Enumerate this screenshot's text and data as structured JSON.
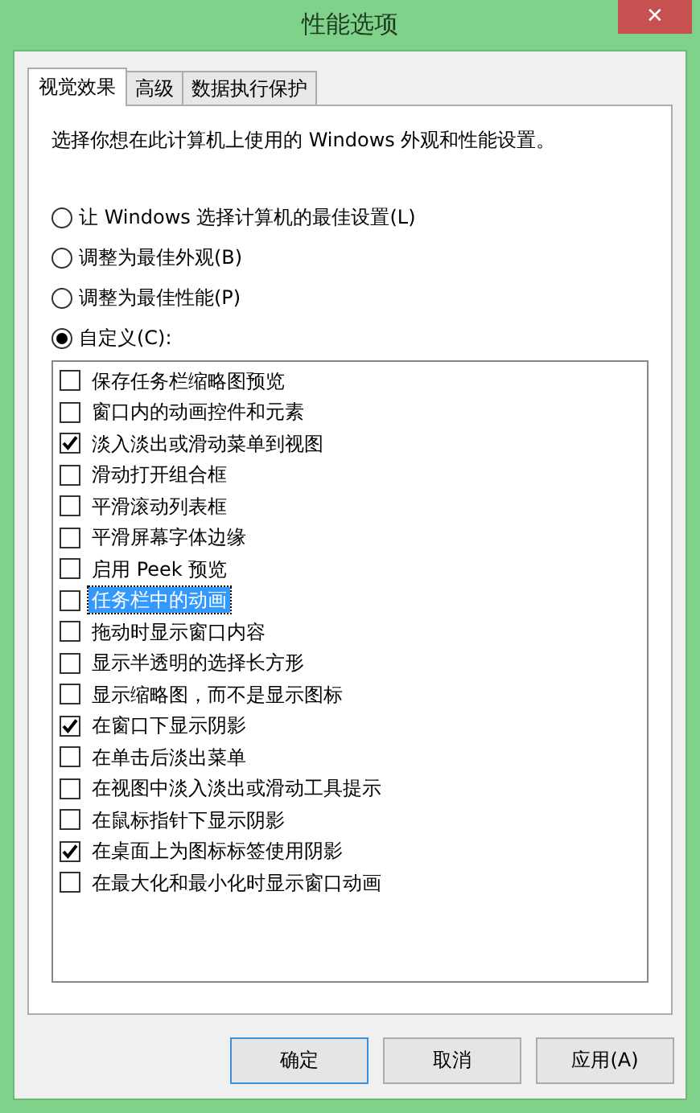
{
  "window": {
    "title": "性能选项",
    "close": "✕"
  },
  "tabs": [
    {
      "label": "视觉效果",
      "selected": true
    },
    {
      "label": "高级",
      "selected": false
    },
    {
      "label": "数据执行保护",
      "selected": false
    }
  ],
  "description": "选择你想在此计算机上使用的 Windows 外观和性能设置。",
  "options": [
    {
      "label": "让 Windows 选择计算机的最佳设置(L)",
      "selected": false
    },
    {
      "label": "调整为最佳外观(B)",
      "selected": false
    },
    {
      "label": "调整为最佳性能(P)",
      "selected": false
    },
    {
      "label": "自定义(C):",
      "selected": true
    }
  ],
  "effects": [
    {
      "label": "保存任务栏缩略图预览",
      "checked": false,
      "selected": false
    },
    {
      "label": "窗口内的动画控件和元素",
      "checked": false,
      "selected": false
    },
    {
      "label": "淡入淡出或滑动菜单到视图",
      "checked": true,
      "selected": false
    },
    {
      "label": "滑动打开组合框",
      "checked": false,
      "selected": false
    },
    {
      "label": "平滑滚动列表框",
      "checked": false,
      "selected": false
    },
    {
      "label": "平滑屏幕字体边缘",
      "checked": false,
      "selected": false
    },
    {
      "label": "启用 Peek 预览",
      "checked": false,
      "selected": false
    },
    {
      "label": "任务栏中的动画",
      "checked": false,
      "selected": true
    },
    {
      "label": "拖动时显示窗口内容",
      "checked": false,
      "selected": false
    },
    {
      "label": "显示半透明的选择长方形",
      "checked": false,
      "selected": false
    },
    {
      "label": "显示缩略图，而不是显示图标",
      "checked": false,
      "selected": false
    },
    {
      "label": "在窗口下显示阴影",
      "checked": true,
      "selected": false
    },
    {
      "label": "在单击后淡出菜单",
      "checked": false,
      "selected": false
    },
    {
      "label": "在视图中淡入淡出或滑动工具提示",
      "checked": false,
      "selected": false
    },
    {
      "label": "在鼠标指针下显示阴影",
      "checked": false,
      "selected": false
    },
    {
      "label": "在桌面上为图标标签使用阴影",
      "checked": true,
      "selected": false
    },
    {
      "label": "在最大化和最小化时显示窗口动画",
      "checked": false,
      "selected": false
    }
  ],
  "buttons": [
    {
      "label": "确定",
      "selected": true
    },
    {
      "label": "取消",
      "selected": false
    },
    {
      "label": "应用(A)",
      "selected": false
    }
  ]
}
